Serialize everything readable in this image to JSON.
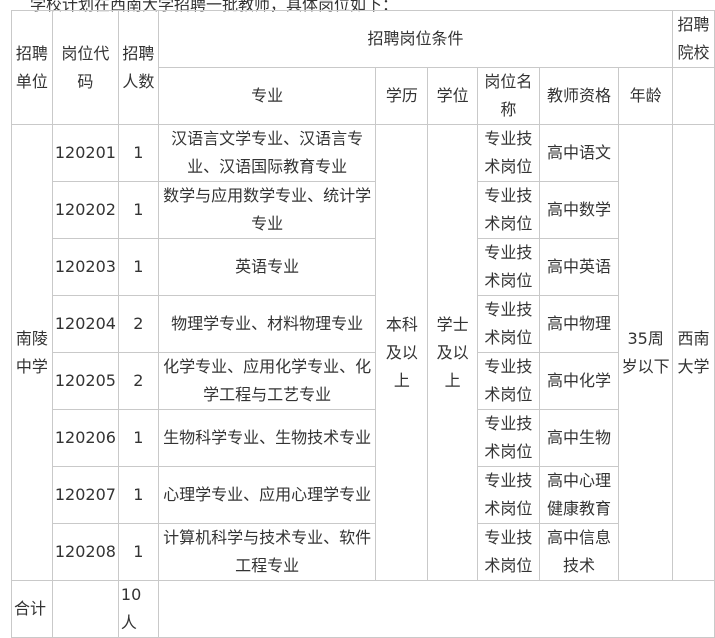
{
  "top_text": "学校计划在西南大学招聘一批教师，具体岗位如下：",
  "headers": {
    "unit": "招聘单位",
    "code": "岗位代码",
    "count": "招聘人数",
    "conditions": "招聘岗位条件",
    "school": "招聘院校",
    "major": "专业",
    "education": "学历",
    "degree": "学位",
    "position": "岗位名称",
    "qualification": "教师资格",
    "age": "年龄"
  },
  "shared": {
    "unit": "南陵中学",
    "education": "本科及以上",
    "degree": "学士及以上",
    "age": "35周岁以下",
    "school": "西南大学"
  },
  "rows": [
    {
      "code": "120201",
      "count": "1",
      "major": "汉语言文学专业、汉语言专业、汉语国际教育专业",
      "position": "专业技术岗位",
      "qualification": "高中语文"
    },
    {
      "code": "120202",
      "count": "1",
      "major": "数学与应用数学专业、统计学专业",
      "position": "专业技术岗位",
      "qualification": "高中数学"
    },
    {
      "code": "120203",
      "count": "1",
      "major": "英语专业",
      "position": "专业技术岗位",
      "qualification": "高中英语"
    },
    {
      "code": "120204",
      "count": "2",
      "major": "物理学专业、材料物理专业",
      "position": "专业技术岗位",
      "qualification": "高中物理"
    },
    {
      "code": "120205",
      "count": "2",
      "major": "化学专业、应用化学专业、化学工程与工艺专业",
      "position": "专业技术岗位",
      "qualification": "高中化学"
    },
    {
      "code": "120206",
      "count": "1",
      "major": "生物科学专业、生物技术专业",
      "position": "专业技术岗位",
      "qualification": "高中生物"
    },
    {
      "code": "120207",
      "count": "1",
      "major": "心理学专业、应用心理学专业",
      "position": "专业技术岗位",
      "qualification": "高中心理健康教育"
    },
    {
      "code": "120208",
      "count": "1",
      "major": "计算机科学与技术专业、软件工程专业",
      "position": "专业技术岗位",
      "qualification": "高中信息技术"
    }
  ],
  "total": {
    "label": "合计",
    "count": "10人"
  }
}
